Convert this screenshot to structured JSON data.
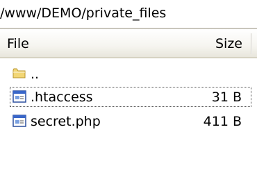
{
  "path": "/www/DEMO/private_files",
  "columns": {
    "file": "File",
    "size": "Size"
  },
  "rows": [
    {
      "name": "..",
      "size": "",
      "icon": "folder-icon"
    },
    {
      "name": ".htaccess",
      "size": "31 B",
      "icon": "file-icon",
      "focused": true
    },
    {
      "name": "secret.php",
      "size": "411 B",
      "icon": "file-icon"
    }
  ],
  "colors": {
    "folder": "#f2d675",
    "file_icon_border": "#2b4f9e",
    "file_icon_title": "#3a67c9"
  }
}
